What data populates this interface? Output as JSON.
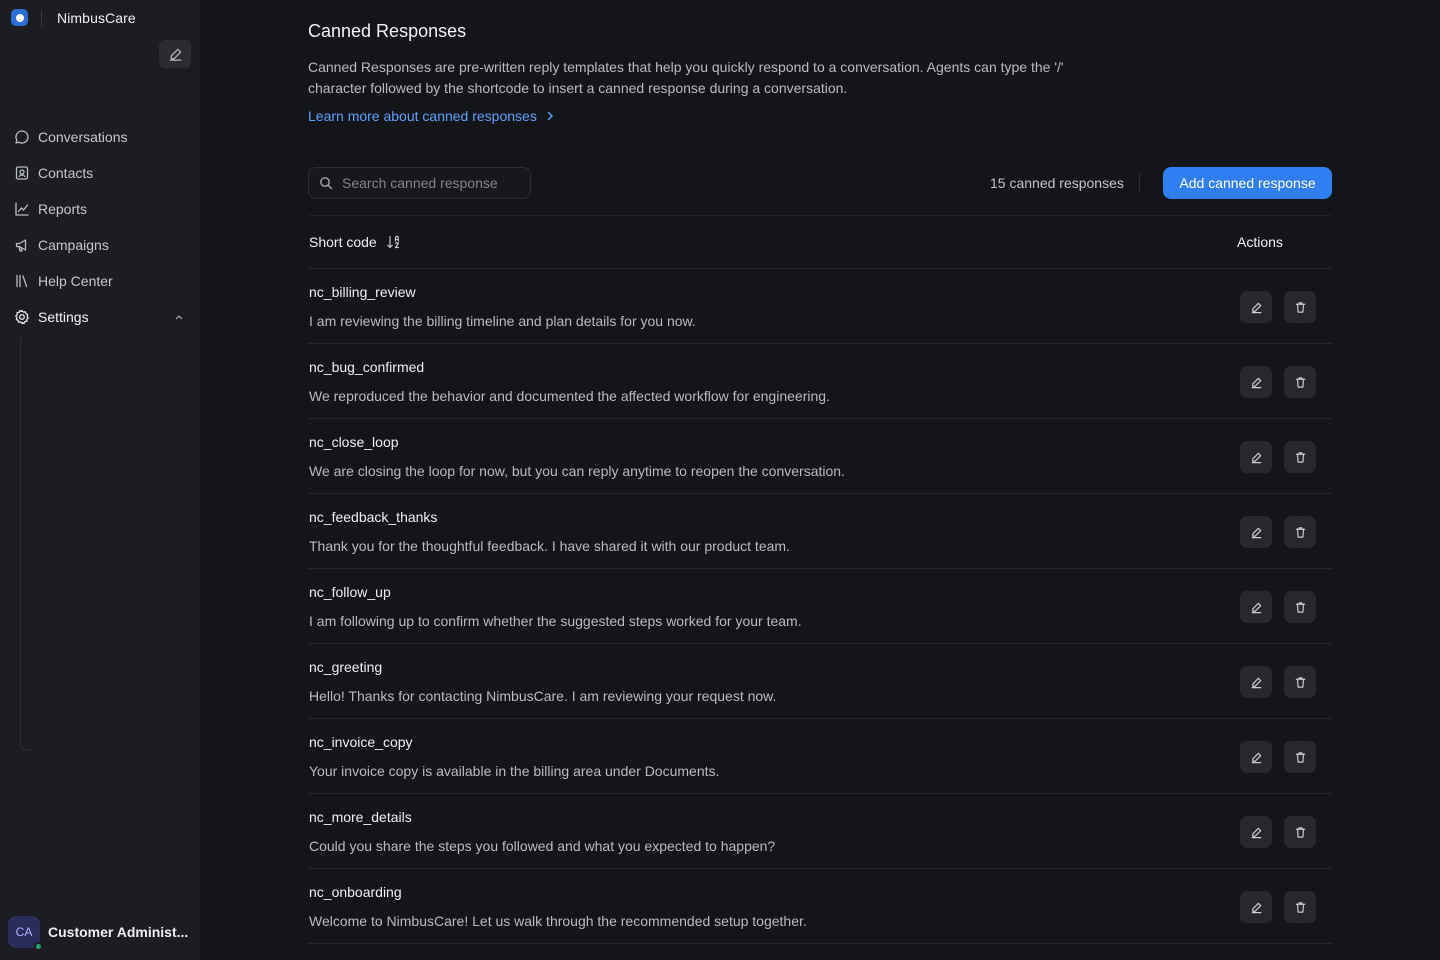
{
  "app": {
    "name": "NimbusCare"
  },
  "sidebar": {
    "items": [
      {
        "label": "Conversations",
        "icon": "chat-bubble-icon"
      },
      {
        "label": "Contacts",
        "icon": "contact-card-icon"
      },
      {
        "label": "Reports",
        "icon": "line-chart-icon"
      },
      {
        "label": "Campaigns",
        "icon": "megaphone-icon"
      },
      {
        "label": "Help Center",
        "icon": "library-icon"
      },
      {
        "label": "Settings",
        "icon": "gear-icon"
      }
    ],
    "user": {
      "initials": "CA",
      "name": "Customer Administ...",
      "status_color": "#23a36c"
    }
  },
  "page": {
    "title": "Canned Responses",
    "description": "Canned Responses are pre-written reply templates that help you quickly respond to a conversation. Agents can type the '/' character followed by the shortcode to insert a canned response during a conversation.",
    "learn_more": "Learn more about canned responses"
  },
  "toolbar": {
    "search_placeholder": "Search canned response",
    "count_label": "15 canned responses",
    "add_label": "Add canned response"
  },
  "table": {
    "headers": {
      "short_code": "Short code",
      "actions": "Actions"
    },
    "rows": [
      {
        "code": "nc_billing_review",
        "content": "I am reviewing the billing timeline and plan details for you now."
      },
      {
        "code": "nc_bug_confirmed",
        "content": "We reproduced the behavior and documented the affected workflow for engineering."
      },
      {
        "code": "nc_close_loop",
        "content": "We are closing the loop for now, but you can reply anytime to reopen the conversation."
      },
      {
        "code": "nc_feedback_thanks",
        "content": "Thank you for the thoughtful feedback. I have shared it with our product team."
      },
      {
        "code": "nc_follow_up",
        "content": "I am following up to confirm whether the suggested steps worked for your team."
      },
      {
        "code": "nc_greeting",
        "content": "Hello! Thanks for contacting NimbusCare. I am reviewing your request now."
      },
      {
        "code": "nc_invoice_copy",
        "content": "Your invoice copy is available in the billing area under Documents."
      },
      {
        "code": "nc_more_details",
        "content": "Could you share the steps you followed and what you expected to happen?"
      },
      {
        "code": "nc_onboarding",
        "content": "Welcome to NimbusCare! Let us walk through the recommended setup together."
      }
    ]
  },
  "colors": {
    "accent": "#2f7ff0",
    "link": "#5aa2ff",
    "background": "#141518",
    "sidebar": "#1c1d21"
  }
}
